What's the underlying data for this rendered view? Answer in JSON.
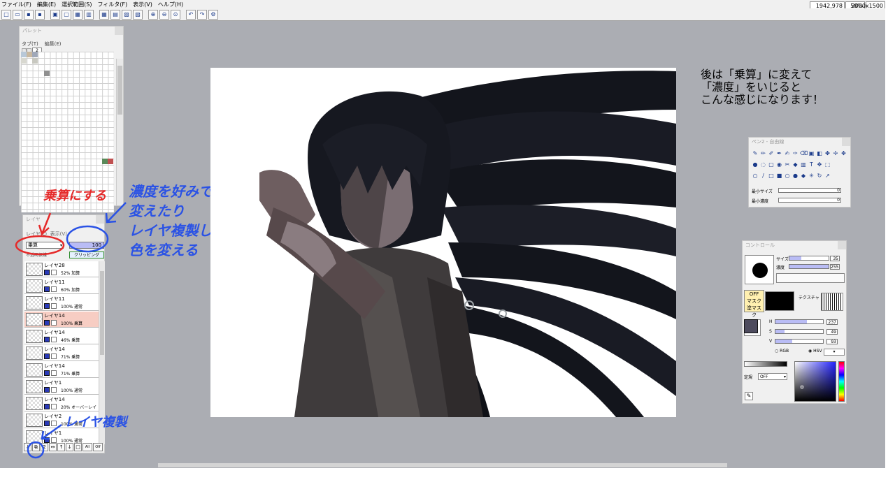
{
  "menu": [
    "ファイル(F)",
    "編集(E)",
    "選択範囲(S)",
    "フィルタ(F)",
    "表示(V)",
    "ヘルプ(H)"
  ],
  "status": {
    "coords": "1942,978",
    "zoom": "50%",
    "size": "2000x1500"
  },
  "palette": {
    "title": "パレット",
    "menu_tab": "タブ(T)",
    "menu_edit": "編集(E)",
    "tab1": "1",
    "tab2": "2"
  },
  "layers": {
    "title": "レイヤ",
    "menu_layer": "レイヤ(L)",
    "menu_view": "表示(V)",
    "blend_mode": "乗算",
    "opacity": "100",
    "protect_label": "不透明保護",
    "clip_label": "クリッピング",
    "items": [
      {
        "name": "レイヤ28",
        "info": "52% 加算"
      },
      {
        "name": "レイヤ11",
        "info": "60% 加算"
      },
      {
        "name": "レイヤ11",
        "info": "100% 通常"
      },
      {
        "name": "レイヤ14",
        "info": "100% 乗算"
      },
      {
        "name": "レイヤ14",
        "info": "46% 乗算"
      },
      {
        "name": "レイヤ14",
        "info": "71% 乗算"
      },
      {
        "name": "レイヤ14",
        "info": "71% 乗算"
      },
      {
        "name": "レイヤ1",
        "info": "100% 通常"
      },
      {
        "name": "レイヤ14",
        "info": "20% オーバーレイ"
      },
      {
        "name": "レイヤ2",
        "info": "100% 通常"
      },
      {
        "name": "レイヤ1",
        "info": "100% 通常"
      }
    ],
    "buttons": [
      "↓",
      "⧉",
      "2",
      "↔",
      "↑",
      "↓",
      "□",
      "All",
      "Off"
    ]
  },
  "annotations": {
    "red": "乗算にする",
    "blue": "濃度を好みで\n変えたり\nレイヤ複製して\n色を変える",
    "blue2": "レイヤ複製"
  },
  "note": "後は「乗算」に変えて\n「濃度」をいじると\nこんな感じになります！",
  "brush_panel": {
    "title": "ペン2 - 自由線",
    "min_size_label": "最小サイズ",
    "min_size_value": "0",
    "min_density_label": "最小濃度",
    "min_density_value": "0"
  },
  "control_panel": {
    "title": "コントロール",
    "size_label": "サイズ",
    "size_value": "35",
    "density_label": "濃度",
    "density_value": "255",
    "off_label": "OFF",
    "mask_label": "マスク",
    "paint_mask_label": "塗マスク",
    "texture_label": "テクスチャ",
    "h_label": "H",
    "h_value": "237",
    "s_label": "S",
    "s_value": "49",
    "v_label": "V",
    "v_value": "93",
    "rgb_label": "RGB",
    "hsv_label": "HSV",
    "fixed_label": "定規",
    "fixed_value": "OFF",
    "fg_color": "#4d4b5e",
    "accent": "#b9bcf5"
  }
}
